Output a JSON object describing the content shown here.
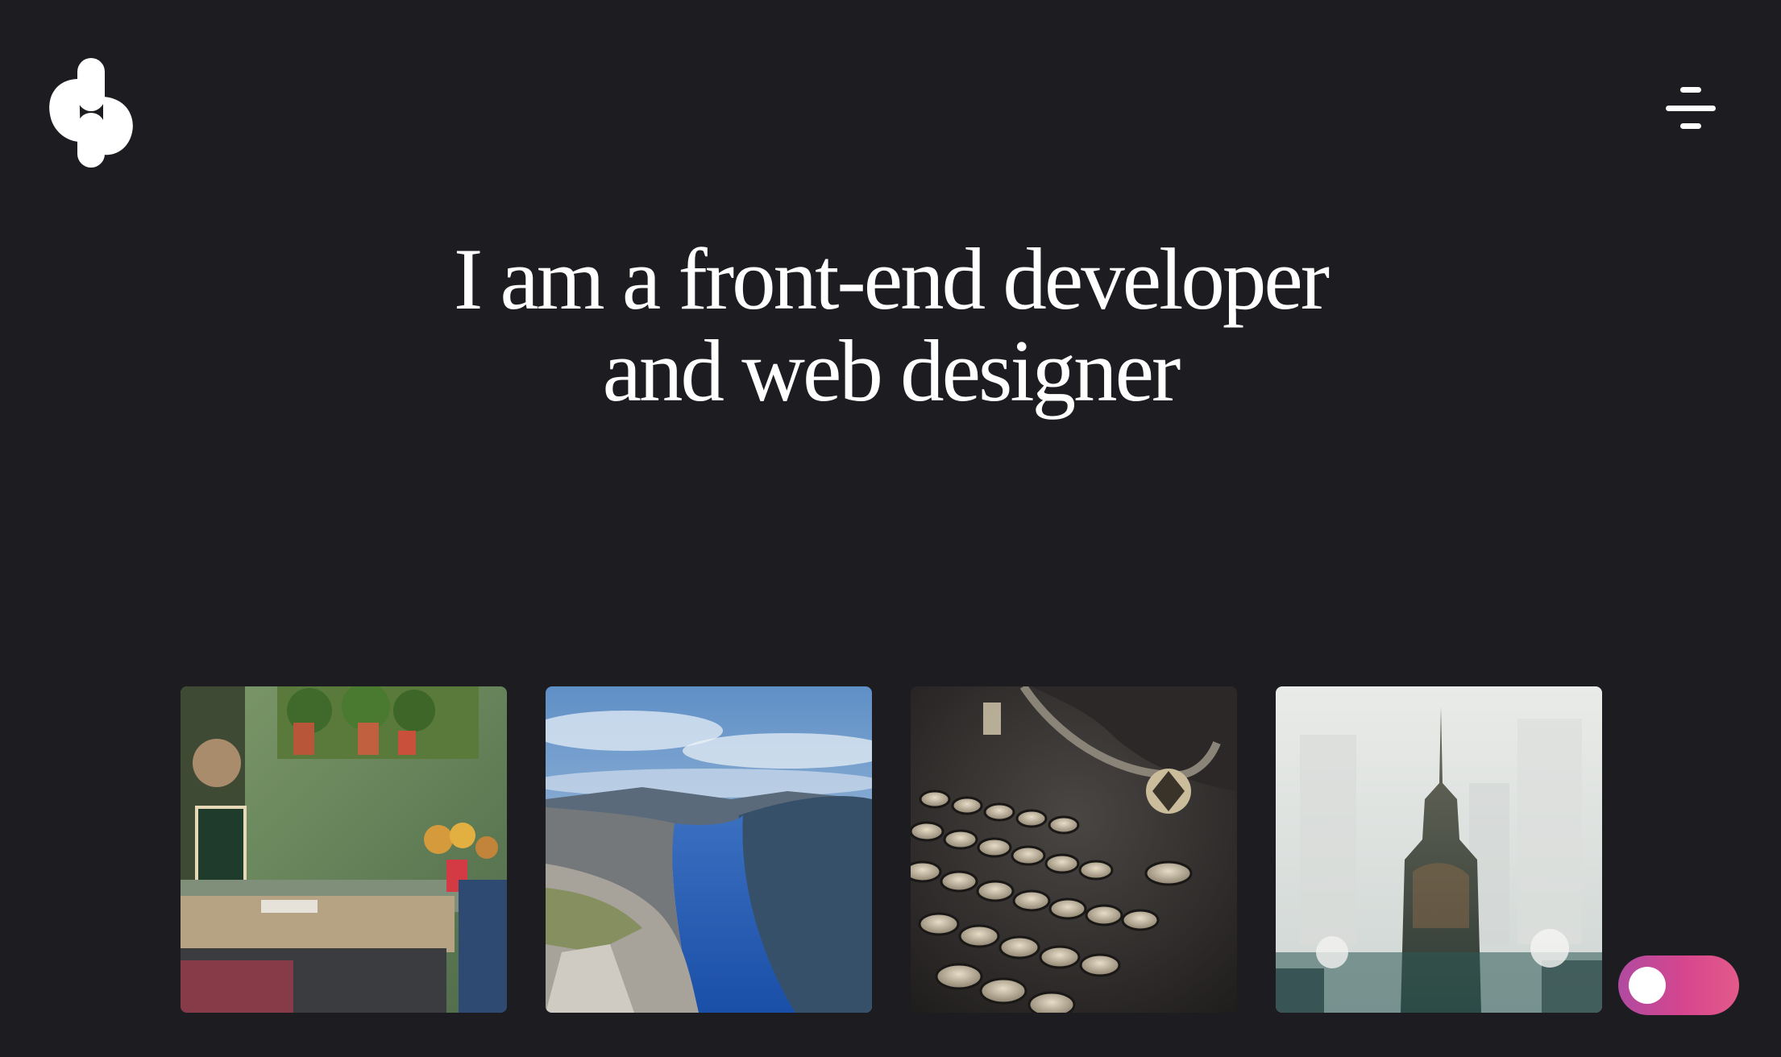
{
  "header": {
    "logo": {
      "icon": "brand-logo-icon"
    },
    "menu": {
      "icon": "hamburger-menu-icon"
    }
  },
  "hero": {
    "line1": "I am a front-end developer",
    "line2": "and web designer"
  },
  "gallery": {
    "items": [
      {
        "subject": "cafe terrace with plants and chalkboard",
        "icon": "cafe-photo"
      },
      {
        "subject": "fjord cliff landscape",
        "icon": "fjord-photo"
      },
      {
        "subject": "vintage typewriter keys",
        "icon": "typewriter-photo"
      },
      {
        "subject": "city skyscraper double exposure",
        "icon": "city-photo"
      }
    ]
  },
  "theme_toggle": {
    "state": "off",
    "icon": "theme-toggle-knob",
    "colors": {
      "start": "#b04aa0",
      "end": "#e35a8a"
    }
  },
  "colors": {
    "background": "#1c1c21",
    "text": "#ffffff"
  }
}
